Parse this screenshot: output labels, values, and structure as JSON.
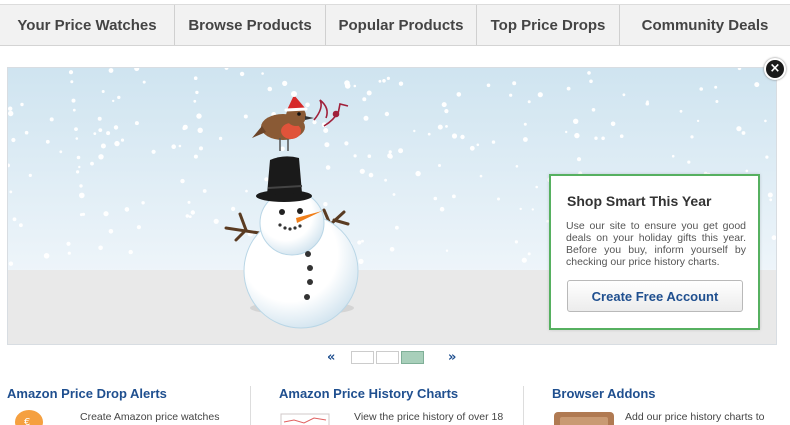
{
  "nav": {
    "items": [
      {
        "label": "Your Price Watches"
      },
      {
        "label": "Browse Products"
      },
      {
        "label": "Popular Products"
      },
      {
        "label": "Top Price Drops"
      },
      {
        "label": "Community Deals"
      }
    ]
  },
  "banner": {
    "close_icon": "×",
    "promo": {
      "title": "Shop Smart This Year",
      "text": "Use our site to ensure you get good deals on your holiday gifts this year. Before you buy, inform yourself by checking our price history charts.",
      "button_label": "Create Free Account"
    }
  },
  "pager": {
    "prev": "«",
    "next": "»",
    "slide_count": 3,
    "active_slide": 3
  },
  "features": [
    {
      "title": "Amazon Price Drop Alerts",
      "text": "Create Amazon price watches",
      "icon": "piggy-bank-icon"
    },
    {
      "title": "Amazon Price History Charts",
      "text": "View the price history of over 18",
      "icon": "chart-icon"
    },
    {
      "title": "Browser Addons",
      "text": "Add our price history charts to",
      "icon": "addon-icon"
    }
  ],
  "colors": {
    "link": "#1f4f8f",
    "promo_border": "#56b060",
    "active_dot": "#a8cfba"
  }
}
